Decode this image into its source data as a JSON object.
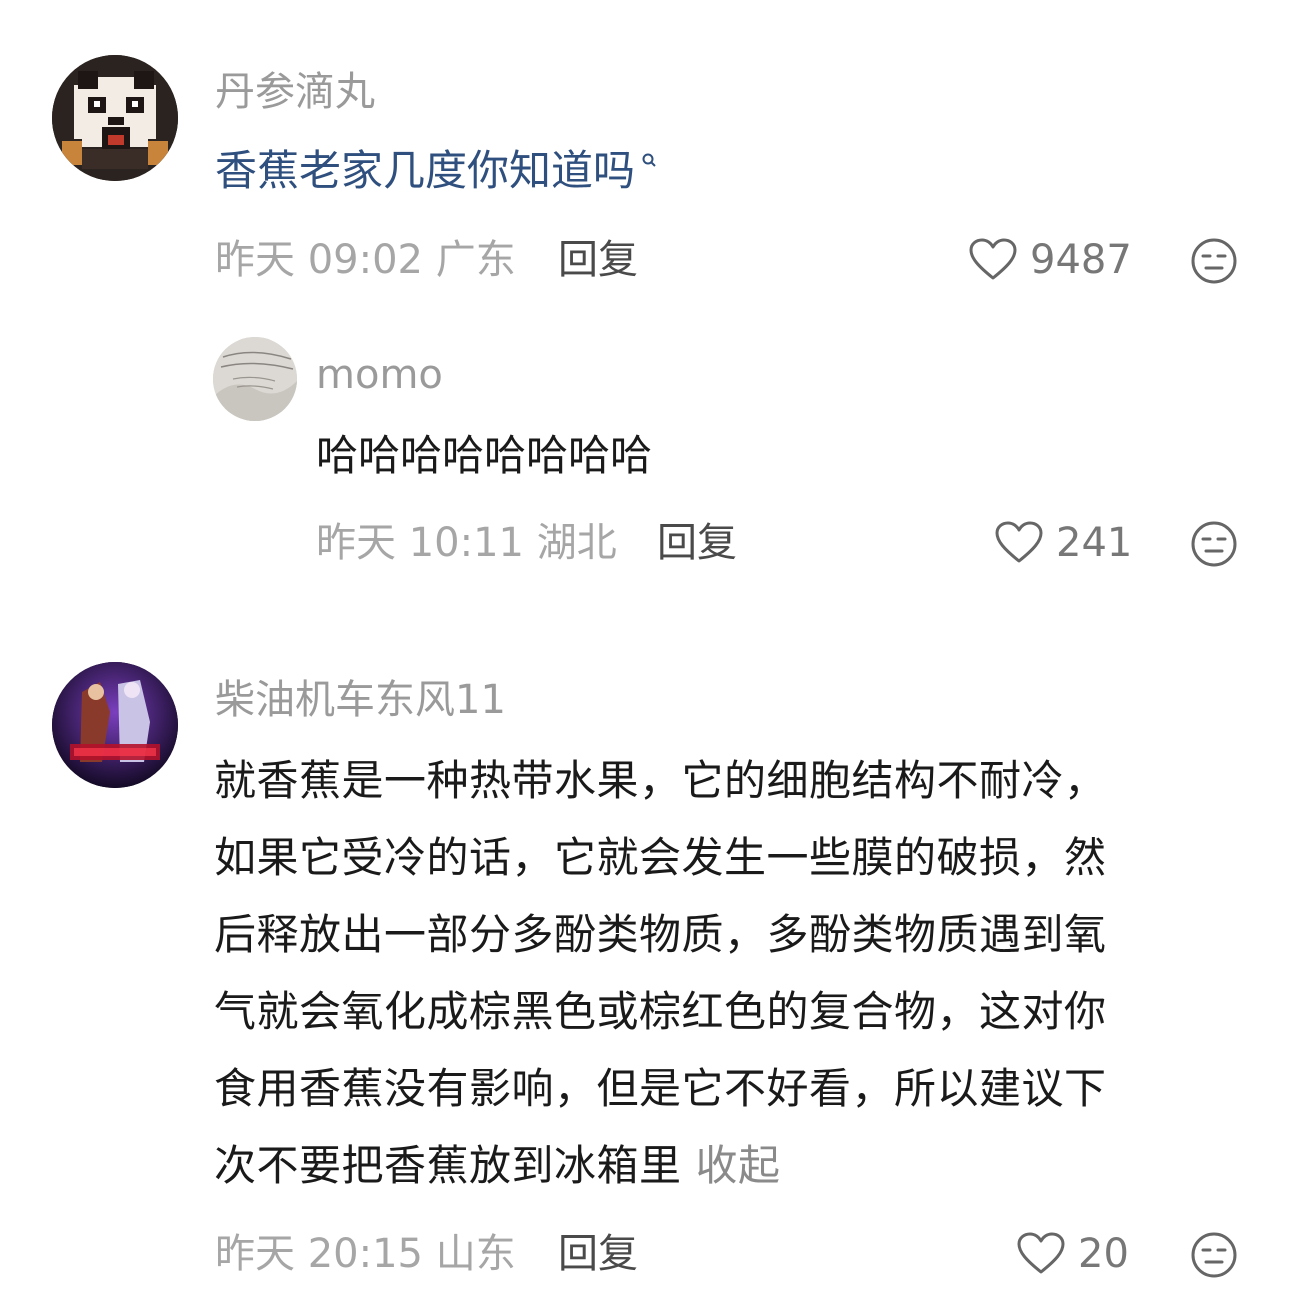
{
  "comments": [
    {
      "username": "丹参滴丸",
      "text": "香蕉老家几度你知道吗",
      "time": "昨天 09:02 广东",
      "reply_label": "回复",
      "likes": "9487",
      "avatar_icon": "panda-pixel-avatar"
    },
    {
      "username": "momo",
      "text": "哈哈哈哈哈哈哈哈",
      "time": "昨天 10:11 湖北",
      "reply_label": "回复",
      "likes": "241",
      "avatar_icon": "fabric-label-avatar"
    },
    {
      "username": "柴油机车东风11",
      "lines": [
        "就香蕉是一种热带水果，它的细胞结构不耐冷，",
        "如果它受冷的话，它就会发生一些膜的破损，然",
        "后释放出一部分多酚类物质，多酚类物质遇到氧",
        "气就会氧化成棕黑色或棕红色的复合物，这对你",
        "食用香蕉没有影响，但是它不好看，所以建议下",
        "次不要把香蕉放到冰箱里"
      ],
      "collapse_label": "收起",
      "time": "昨天 20:15 山东",
      "reply_label": "回复",
      "likes": "20",
      "avatar_icon": "anime-characters-avatar"
    }
  ],
  "colors": {
    "username": "#9a9a9a",
    "link_text": "#2f4f7e",
    "meta": "#a6a6a6"
  }
}
